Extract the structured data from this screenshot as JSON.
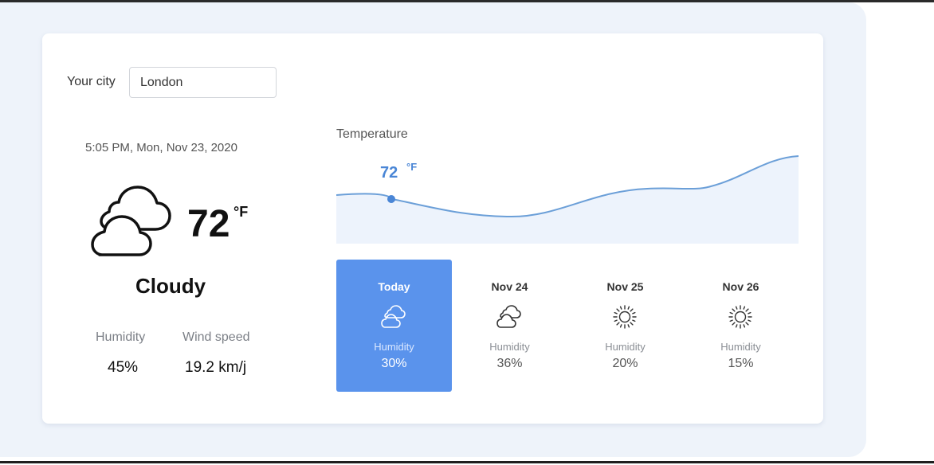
{
  "city": {
    "label": "Your city",
    "value": "London",
    "placeholder": ""
  },
  "current": {
    "datetime": "5:05 PM, Mon, Nov 23, 2020",
    "temperature": "72",
    "unit": "°F",
    "condition": "Cloudy",
    "icon": "cloud-icon",
    "humidity_label": "Humidity",
    "humidity_value": "45%",
    "wind_label": "Wind speed",
    "wind_value": "19.2 km/j"
  },
  "chart": {
    "title": "Temperature",
    "highlight_value": "72",
    "highlight_unit": "°F",
    "accent_color": "#5a93ec",
    "line_color": "#6b9fd8",
    "fill_color": "#edf3fc"
  },
  "forecast": [
    {
      "day": "Today",
      "icon": "cloud-icon",
      "humidity_label": "Humidity",
      "humidity_value": "30%",
      "active": true
    },
    {
      "day": "Nov 24",
      "icon": "cloud-icon",
      "humidity_label": "Humidity",
      "humidity_value": "36%",
      "active": false
    },
    {
      "day": "Nov 25",
      "icon": "sun-icon",
      "humidity_label": "Humidity",
      "humidity_value": "20%",
      "active": false
    },
    {
      "day": "Nov 26",
      "icon": "sun-icon",
      "humidity_label": "Humidity",
      "humidity_value": "15%",
      "active": false
    }
  ]
}
